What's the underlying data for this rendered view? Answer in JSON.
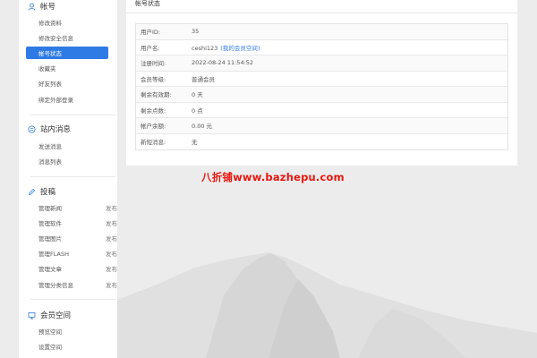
{
  "sidebar": {
    "groups": [
      {
        "title": "帐号",
        "icon": "user-icon",
        "items": [
          {
            "label": "修改资料"
          },
          {
            "label": "修改安全信息"
          },
          {
            "label": "帐号状态",
            "active": true
          },
          {
            "label": "收藏夹"
          },
          {
            "label": "好友列表"
          },
          {
            "label": "绑定外部登录"
          }
        ]
      },
      {
        "title": "站内消息",
        "icon": "message-icon",
        "items": [
          {
            "label": "发送消息"
          },
          {
            "label": "消息列表"
          }
        ]
      },
      {
        "title": "投稿",
        "icon": "edit-icon",
        "items": [
          {
            "label": "管理新闻",
            "action": "发布"
          },
          {
            "label": "管理软件",
            "action": "发布"
          },
          {
            "label": "管理图片",
            "action": "发布"
          },
          {
            "label": "管理FLASH",
            "action": "发布"
          },
          {
            "label": "管理文章",
            "action": "发布"
          },
          {
            "label": "管理分类信息",
            "action": "发布"
          }
        ]
      },
      {
        "title": "会员空间",
        "icon": "monitor-icon",
        "items": [
          {
            "label": "预览空间"
          },
          {
            "label": "设置空间"
          }
        ]
      }
    ]
  },
  "panel": {
    "title": "帐号状态",
    "rows": [
      {
        "label": "用户ID:",
        "value": "35"
      },
      {
        "label": "用户名:",
        "value": "ceshi123",
        "link": "(我的会员空间)"
      },
      {
        "label": "注册时间:",
        "value": "2022-08-24 11:54:52"
      },
      {
        "label": "会员等级:",
        "value": "普通会员"
      },
      {
        "label": "剩余有效期:",
        "value": "0 天"
      },
      {
        "label": "剩余点数:",
        "value": "0 点"
      },
      {
        "label": "帐户余额:",
        "value": "0.00 元"
      },
      {
        "label": "新短消息:",
        "value": "无"
      }
    ]
  },
  "watermark": "八折铺www.bazhepu.com",
  "colors": {
    "accent": "#2f7be6",
    "watermark": "#e8170f",
    "background": "#ececec"
  }
}
